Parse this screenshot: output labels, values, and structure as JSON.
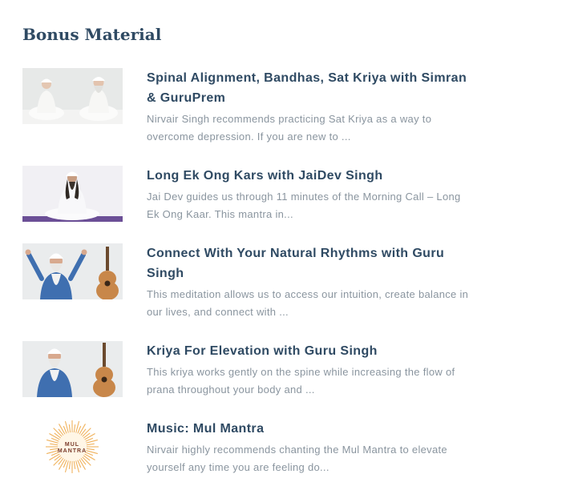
{
  "section": {
    "heading": "Bonus Material"
  },
  "items": [
    {
      "title": "Spinal Alignment, Bandhas, Sat Kriya with Simran & GuruPrem",
      "description": "Nirvair Singh recommends practicing Sat Kriya as a way to overcome depression. If you are new to ...",
      "thumbnail": "two-people-meditating"
    },
    {
      "title": "Long Ek Ong Kars with JaiDev Singh",
      "description": "Jai Dev guides us through 11 minutes of the Morning Call – Long Ek Ong Kaar. This mantra in...",
      "thumbnail": "man-meditating-white-turban"
    },
    {
      "title": "Connect With Your Natural Rhythms with Guru Singh",
      "description": "This meditation allows us to access our intuition, create balance in our lives, and connect with ...",
      "thumbnail": "guru-singh-with-guitar-arms-raised"
    },
    {
      "title": "Kriya For Elevation with Guru Singh",
      "description": "This kriya works gently on the spine while increasing the flow of prana throughout your body and ...",
      "thumbnail": "guru-singh-with-guitar"
    },
    {
      "title": "Music: Mul Mantra",
      "description": "Nirvair highly recommends chanting the Mul Mantra to elevate yourself any time you are feeling do...",
      "thumbnail": "mul-mantra-sunburst-logo",
      "logo_text": "MUL MANTRA"
    }
  ]
}
